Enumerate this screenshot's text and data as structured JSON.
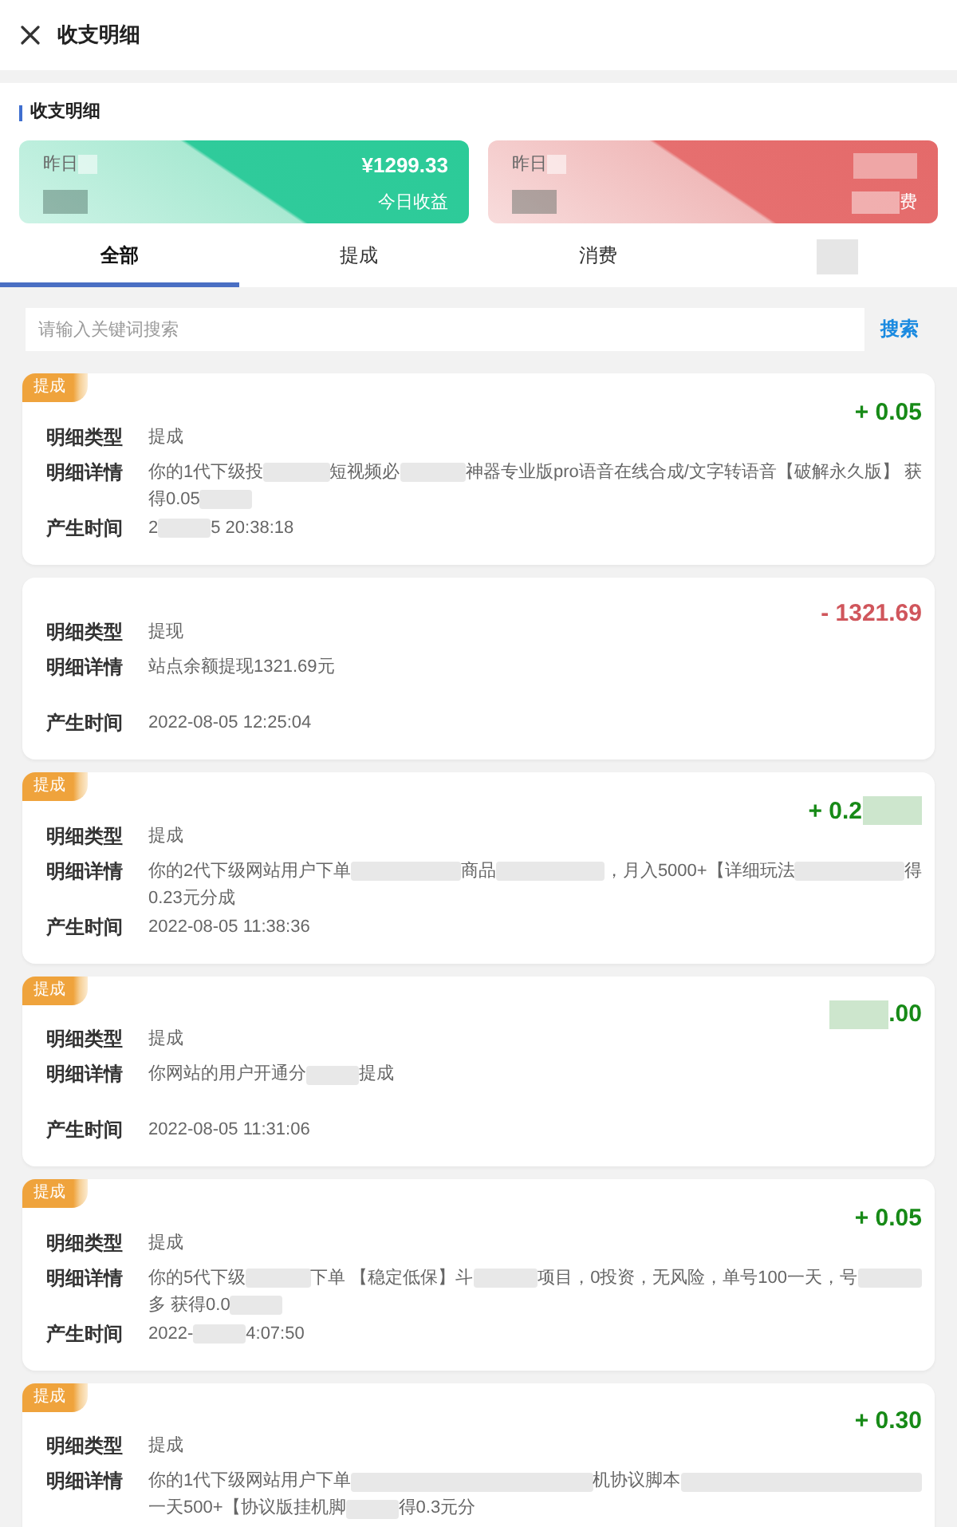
{
  "header": {
    "title": "收支明细"
  },
  "summary": {
    "title": "收支明细",
    "stat_cards": [
      {
        "kind": "income",
        "label": [
          {
            "kind": "text",
            "text": "昨日"
          },
          {
            "kind": "redacted"
          }
        ],
        "value": [
          {
            "kind": "redacted"
          }
        ],
        "amount": "¥1299.33",
        "caption": "今日收益"
      },
      {
        "kind": "expense",
        "label": [
          {
            "kind": "text",
            "text": "昨日"
          },
          {
            "kind": "redacted"
          }
        ],
        "value": [
          {
            "kind": "redacted"
          }
        ],
        "amount": [
          {
            "kind": "redacted"
          }
        ],
        "caption": [
          {
            "kind": "redacted"
          },
          {
            "kind": "text",
            "text": "费"
          }
        ]
      }
    ]
  },
  "tabs": [
    {
      "label": "全部",
      "selected": true
    },
    {
      "label": "提成",
      "selected": false
    },
    {
      "label": "消费",
      "selected": false
    },
    {
      "label": [
        {
          "kind": "redacted"
        }
      ],
      "selected": false
    }
  ],
  "search": {
    "placeholder": "请输入关键词搜索",
    "button": "搜索"
  },
  "records": [
    {
      "badge": "提成",
      "kind": "income",
      "amount": "+ 0.05",
      "fields": [
        {
          "kind": "type",
          "label": "明细类型",
          "value": "提成"
        },
        {
          "kind": "detail",
          "label": "明细详情",
          "value": [
            [
              {
                "kind": "text",
                "text": "你的1代下级投"
              },
              {
                "kind": "redacted"
              },
              {
                "kind": "text",
                "text": "短视频必"
              },
              {
                "kind": "redacted"
              },
              {
                "kind": "text",
                "text": "神器专业版pro语音在线合成/文字转语音【破解永久版】 获"
              }
            ],
            [
              {
                "kind": "text",
                "text": "得0.05"
              },
              {
                "kind": "redacted"
              }
            ]
          ]
        },
        {
          "kind": "time",
          "label": "产生时间",
          "value": [
            [
              {
                "kind": "text",
                "text": "2"
              },
              {
                "kind": "redacted"
              },
              {
                "kind": "text",
                "text": "5 20:38:18"
              }
            ]
          ]
        }
      ]
    },
    {
      "kind": "expense",
      "amount": "- 1321.69",
      "fields": [
        {
          "kind": "type",
          "label": "明细类型",
          "value": "提现"
        },
        {
          "kind": "detail",
          "label": "明细详情",
          "value": "站点余额提现1321.69元"
        },
        {
          "kind": "time",
          "label": "产生时间",
          "value": "2022-08-05 12:25:04"
        }
      ]
    },
    {
      "badge": "提成",
      "kind": "income",
      "amount": [
        {
          "kind": "text",
          "text": "+ 0.2"
        },
        {
          "kind": "redacted"
        }
      ],
      "fields": [
        {
          "kind": "type",
          "label": "明细类型",
          "value": "提成"
        },
        {
          "kind": "detail",
          "label": "明细详情",
          "value": [
            [
              {
                "kind": "text",
                "text": "你的2代下级网站用户下单"
              },
              {
                "kind": "redacted"
              },
              {
                "kind": "text",
                "text": "商品"
              },
              {
                "kind": "redacted"
              },
              {
                "kind": "text",
                "text": "，月入5000+【详细玩法"
              },
              {
                "kind": "redacted"
              },
              {
                "kind": "text",
                "text": "得"
              }
            ],
            [
              {
                "kind": "text",
                "text": "0.23元分成"
              }
            ]
          ]
        },
        {
          "kind": "time",
          "label": "产生时间",
          "value": "2022-08-05 11:38:36"
        }
      ]
    },
    {
      "badge": "提成",
      "kind": "income",
      "amount": [
        {
          "kind": "redacted"
        },
        {
          "kind": "text",
          "text": ".00"
        }
      ],
      "fields": [
        {
          "kind": "type",
          "label": "明细类型",
          "value": "提成"
        },
        {
          "kind": "detail",
          "label": "明细详情",
          "value": [
            [
              {
                "kind": "text",
                "text": "你网站的用户开通分"
              },
              {
                "kind": "redacted"
              },
              {
                "kind": "text",
                "text": "提成"
              }
            ]
          ]
        },
        {
          "kind": "time",
          "label": "产生时间",
          "value": "2022-08-05 11:31:06"
        }
      ]
    },
    {
      "badge": "提成",
      "kind": "income",
      "amount": "+ 0.05",
      "fields": [
        {
          "kind": "type",
          "label": "明细类型",
          "value": "提成"
        },
        {
          "kind": "detail",
          "label": "明细详情",
          "value": [
            [
              {
                "kind": "text",
                "text": "你的5代下级"
              },
              {
                "kind": "redacted"
              },
              {
                "kind": "text",
                "text": "下单 【稳定低保】斗"
              },
              {
                "kind": "redacted"
              },
              {
                "kind": "text",
                "text": "项目，0投资，无风险，单号100一天，号"
              },
              {
                "kind": "redacted"
              }
            ],
            [
              {
                "kind": "text",
                "text": "多 获得0.0"
              },
              {
                "kind": "redacted"
              }
            ]
          ]
        },
        {
          "kind": "time",
          "label": "产生时间",
          "value": [
            [
              {
                "kind": "text",
                "text": "2022-"
              },
              {
                "kind": "redacted"
              },
              {
                "kind": "text",
                "text": "4:07:50"
              }
            ]
          ]
        }
      ]
    },
    {
      "badge": "提成",
      "kind": "income",
      "amount": "+ 0.30",
      "fields": [
        {
          "kind": "type",
          "label": "明细类型",
          "value": "提成"
        },
        {
          "kind": "detail",
          "label": "明细详情",
          "value": [
            [
              {
                "kind": "text",
                "text": "你的1代下级网站用户下单"
              },
              {
                "kind": "redacted"
              },
              {
                "kind": "text",
                "text": "机协议脚本"
              },
              {
                "kind": "redacted"
              }
            ],
            [
              {
                "kind": "text",
                "text": "一天500+【协议版挂机脚"
              },
              {
                "kind": "redacted"
              },
              {
                "kind": "text",
                "text": "得0.3元分"
              }
            ]
          ]
        }
      ]
    }
  ]
}
